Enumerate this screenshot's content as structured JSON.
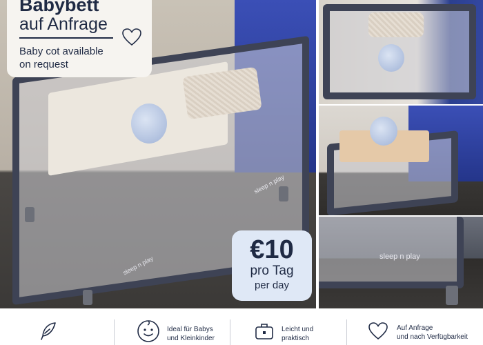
{
  "title": {
    "line1": "Babybett",
    "line2": "auf Anfrage",
    "subtitle_line1": "Baby cot available",
    "subtitle_line2": "on request"
  },
  "price": {
    "amount": "€10",
    "per_day_de": "pro Tag",
    "per_day_en": "per day"
  },
  "photos": {
    "brand_text": "sleep n play"
  },
  "features": [
    {
      "icon": "feather-icon",
      "line1": "",
      "line2": ""
    },
    {
      "icon": "baby-face-icon",
      "line1": "Ideal für Babys",
      "line2": "und Kleinkinder"
    },
    {
      "icon": "suitcase-icon",
      "line1": "Leicht und",
      "line2": "praktisch"
    },
    {
      "icon": "heart-icon",
      "line1": "Auf Anfrage",
      "line2": "und nach Verfügbarkeit"
    }
  ],
  "colors": {
    "navy": "#1f2a44",
    "card_bg": "#f6f4f0",
    "price_bg": "#dfe8f6"
  }
}
